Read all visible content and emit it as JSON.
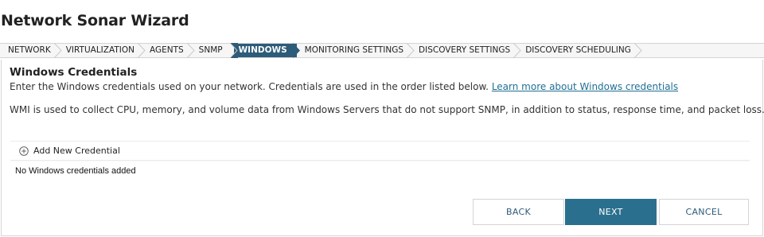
{
  "window": {
    "title": "Network Sonar Wizard"
  },
  "steps": [
    {
      "label": "NETWORK",
      "active": false
    },
    {
      "label": "VIRTUALIZATION",
      "active": false
    },
    {
      "label": "AGENTS",
      "active": false
    },
    {
      "label": "SNMP",
      "active": false
    },
    {
      "label": "WINDOWS",
      "active": true
    },
    {
      "label": "MONITORING SETTINGS",
      "active": false
    },
    {
      "label": "DISCOVERY SETTINGS",
      "active": false
    },
    {
      "label": "DISCOVERY SCHEDULING",
      "active": false
    }
  ],
  "section": {
    "title": "Windows Credentials",
    "description": "Enter the Windows credentials used on your network. Credentials are used in the order listed below.",
    "learn_more": "Learn more about Windows credentials",
    "wmi_note": "WMI is used to collect CPU, memory, and volume data from Windows Servers that do not support SNMP, in addition to status, response time, and packet loss."
  },
  "credentials": {
    "add_label": "Add New Credential",
    "empty_text": "No Windows credentials added"
  },
  "buttons": {
    "back": "BACK",
    "next": "NEXT",
    "cancel": "CANCEL"
  },
  "colors": {
    "accent": "#2b6f8e",
    "active_step": "#2d5b7a",
    "link": "#1f6f95"
  }
}
